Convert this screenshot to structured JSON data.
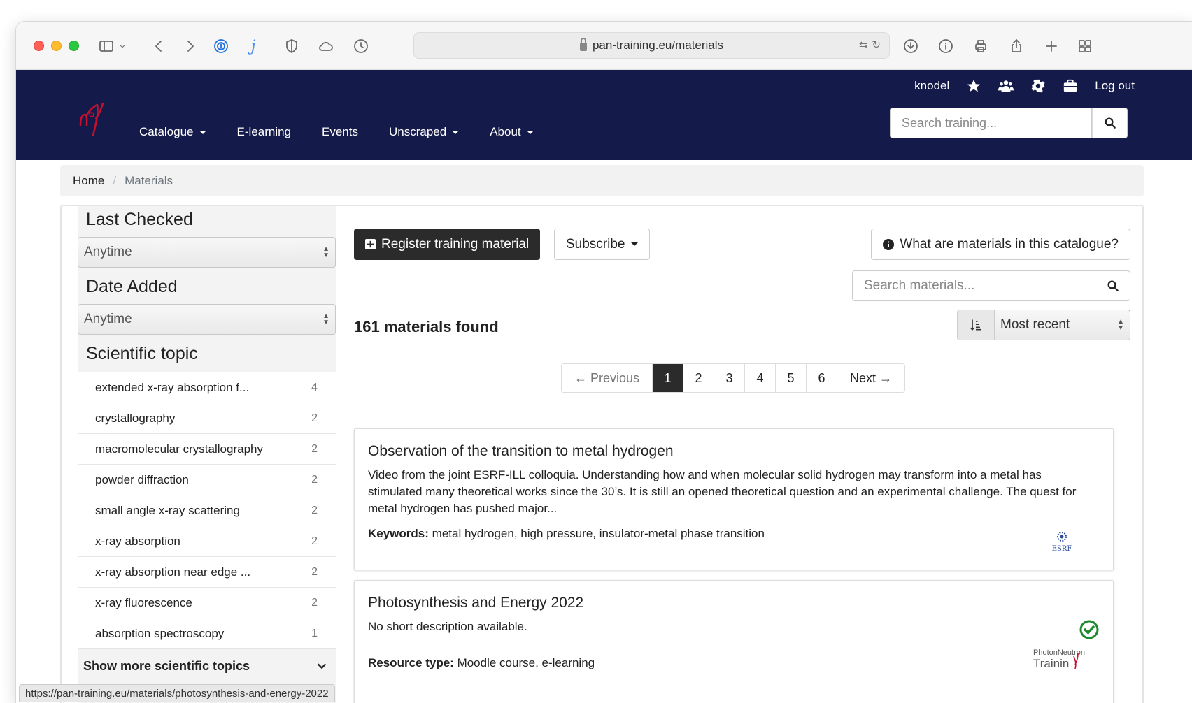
{
  "browser": {
    "url": "pan-training.eu/materials",
    "status_url": "https://pan-training.eu/materials/photosynthesis-and-energy-2022"
  },
  "navbar": {
    "user": "knodel",
    "logout": "Log out",
    "links": [
      {
        "label": "Catalogue",
        "dropdown": true
      },
      {
        "label": "E-learning",
        "dropdown": false
      },
      {
        "label": "Events",
        "dropdown": false
      },
      {
        "label": "Unscraped",
        "dropdown": true
      },
      {
        "label": "About",
        "dropdown": true
      }
    ],
    "search_placeholder": "Search training...",
    "bg_color": "#141a4a",
    "logo_color": "#c8102e"
  },
  "breadcrumb": {
    "home": "Home",
    "separator": "/",
    "current": "Materials"
  },
  "sidebar": {
    "last_checked": {
      "heading": "Last Checked",
      "value": "Anytime"
    },
    "date_added": {
      "heading": "Date Added",
      "value": "Anytime"
    },
    "topic_heading": "Scientific topic",
    "topics": [
      {
        "label": "extended x-ray absorption f...",
        "count": "4"
      },
      {
        "label": "crystallography",
        "count": "2"
      },
      {
        "label": "macromolecular crystallography",
        "count": "2"
      },
      {
        "label": "powder diffraction",
        "count": "2"
      },
      {
        "label": "small angle x-ray scattering",
        "count": "2"
      },
      {
        "label": "x-ray absorption",
        "count": "2"
      },
      {
        "label": "x-ray absorption near edge ...",
        "count": "2"
      },
      {
        "label": "x-ray fluorescence",
        "count": "2"
      },
      {
        "label": "absorption spectroscopy",
        "count": "1"
      }
    ],
    "show_more": "Show more scientific topics"
  },
  "content": {
    "register_label": "Register training material",
    "subscribe_label": "Subscribe",
    "info_label": "What are materials in this catalogue?",
    "search_placeholder": "Search materials...",
    "found": "161 materials found",
    "sort_value": "Most recent",
    "pagination": {
      "prev": "← Previous",
      "pages": [
        "1",
        "2",
        "3",
        "4",
        "5",
        "6"
      ],
      "active": "1",
      "next": "Next →"
    },
    "cards": [
      {
        "title": "Observation of the transition to metal hydrogen",
        "description": "Video from the joint ESRF-ILL colloquia. Understanding how and when molecular solid hydrogen may transform into a metal has stimulated many theoretical works since the 30’s. It is still an opened theoretical question and an experimental challenge. The quest for metal hydrogen has pushed major...",
        "meta_label": "Keywords:",
        "meta_value": "metal hydrogen, high pressure, insulator-metal phase transition",
        "logo_text": "ESRF"
      },
      {
        "title": "Photosynthesis and Energy 2022",
        "description": "No short description available.",
        "meta_label": "Resource type:",
        "meta_value": "Moodle course, e-learning",
        "logo_text": "Photon and Neutron Training"
      }
    ]
  }
}
